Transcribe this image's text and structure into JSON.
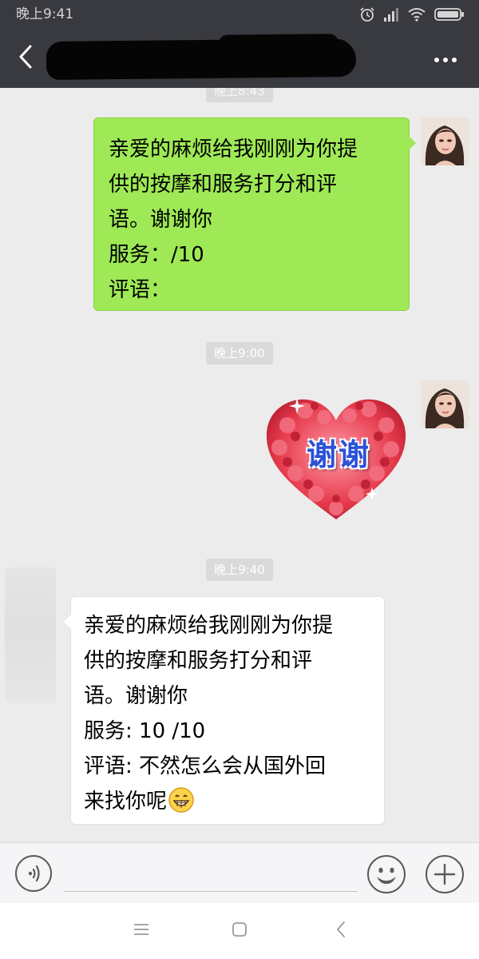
{
  "status_bar": {
    "time": "晚上9:41",
    "icons": [
      "alarm-icon",
      "signal-icon",
      "wifi-icon",
      "battery-icon"
    ]
  },
  "nav_bar": {
    "back_icon": "chevron-left-icon",
    "more_icon": "more-dots-icon"
  },
  "chat": {
    "messages": [
      {
        "type": "timestamp",
        "text": "晚上8:43"
      },
      {
        "type": "text",
        "direction": "sent",
        "lines": [
          "亲爱的麻烦给我刚刚为你提",
          "供的按摩和服务打分和评",
          "语。谢谢你",
          "服务：/10",
          "评语："
        ]
      },
      {
        "type": "timestamp",
        "text": "晚上9:00"
      },
      {
        "type": "sticker",
        "direction": "sent",
        "text": "谢谢"
      },
      {
        "type": "timestamp",
        "text": "晚上9:40"
      },
      {
        "type": "text",
        "direction": "received",
        "lines": [
          "亲爱的麻烦给我刚刚为你提",
          "供的按摩和服务打分和评",
          "语。谢谢你",
          "服务: 10 /10",
          "评语: 不然怎么会从国外回",
          "来找你呢"
        ],
        "trailing_emoji": "grinning-face-icon"
      }
    ]
  },
  "input_bar": {
    "voice_icon": "voice-icon",
    "emoji_icon": "emoji-icon",
    "plus_icon": "plus-icon",
    "input_value": ""
  },
  "system_nav": {
    "icons": [
      "menu-icon",
      "home-icon",
      "back-icon"
    ]
  },
  "colors": {
    "header": "#393a3f",
    "sent_bubble": "#9ee955",
    "received_bubble": "#ffffff",
    "chat_background": "#ececec",
    "sticker_text": "#2b51d6"
  }
}
